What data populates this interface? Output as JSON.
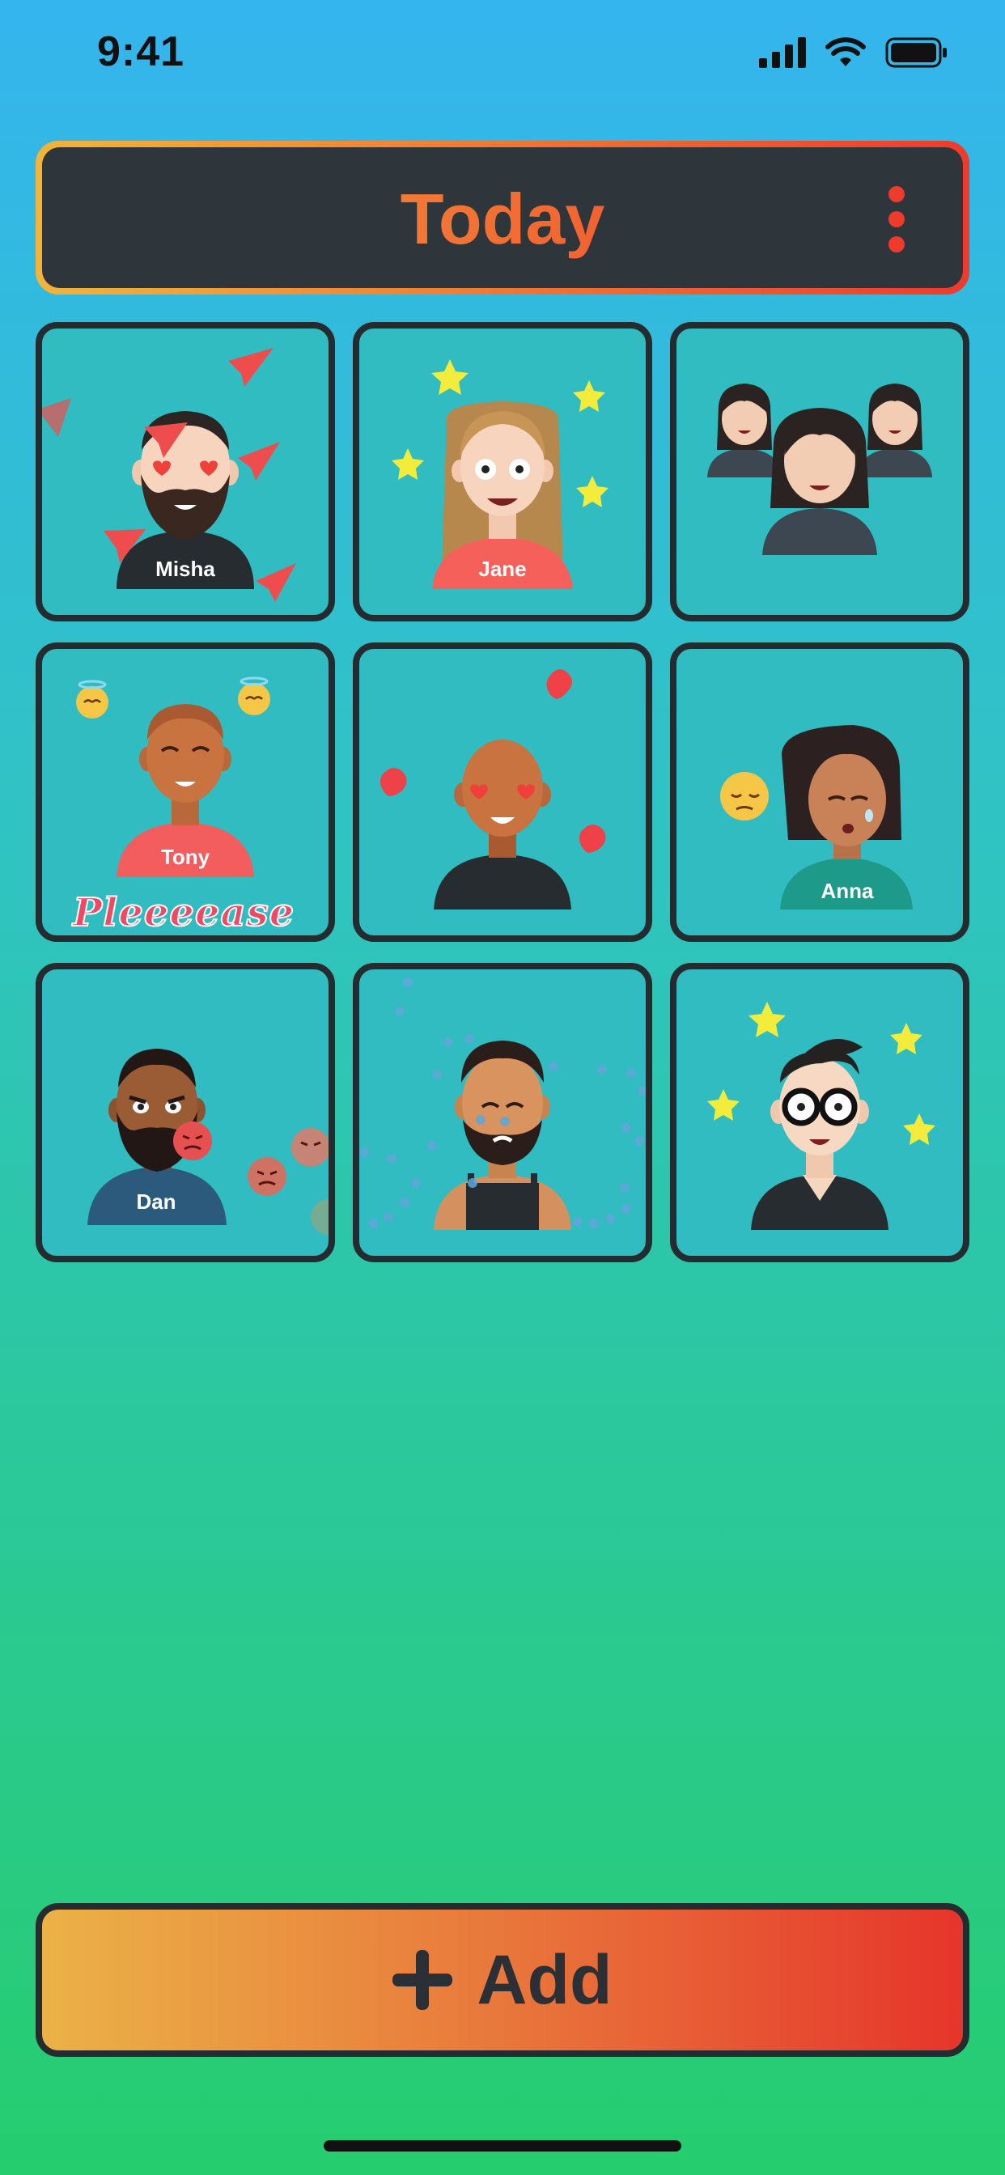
{
  "status_bar": {
    "time": "9:41"
  },
  "header": {
    "title": "Today",
    "menu_icon": "more-vertical-icon"
  },
  "cards": [
    {
      "name": "Misha",
      "effect": "paper-plane-icon"
    },
    {
      "name": "Jane",
      "effect": "star-icon"
    },
    {
      "name": "",
      "effect": "group-avatars"
    },
    {
      "name": "Tony",
      "effect": "angel-emoji-icon",
      "caption": "Pleeeease"
    },
    {
      "name": "",
      "effect": "heart-icon"
    },
    {
      "name": "Anna",
      "effect": "sad-emoji-icon"
    },
    {
      "name": "Dan",
      "effect": "angry-emoji-icon"
    },
    {
      "name": "",
      "effect": "tear-drop-icon"
    },
    {
      "name": "",
      "effect": "star-icon"
    }
  ],
  "add_button": {
    "label": "Add",
    "icon": "plus-icon"
  },
  "colors": {
    "accent_start": "#f2b43b",
    "accent_end": "#ef3a2c",
    "card_bg": "#30bcc0",
    "dark": "#252c30"
  }
}
